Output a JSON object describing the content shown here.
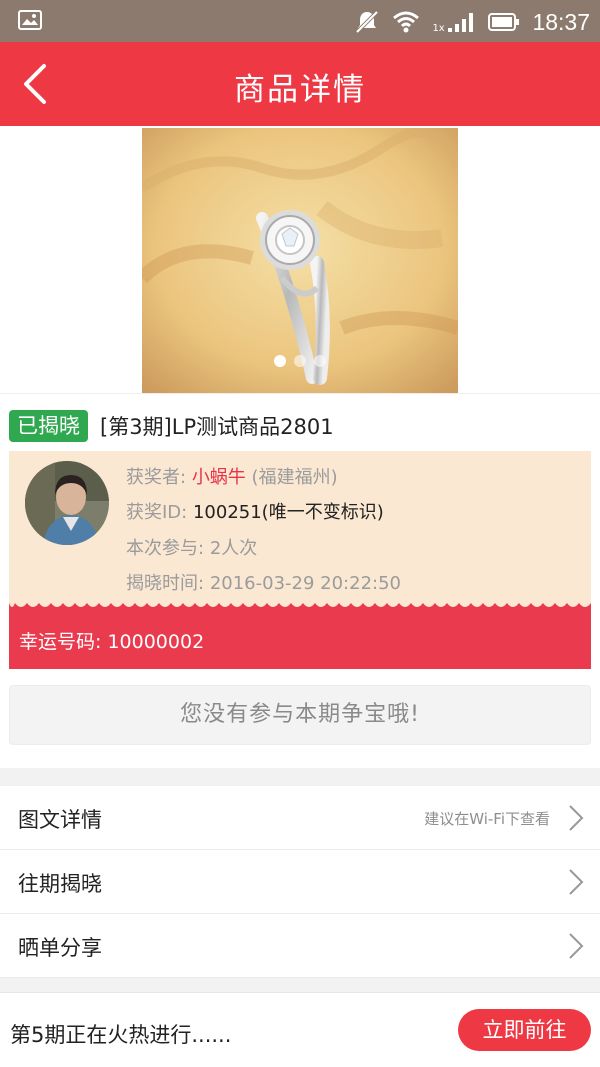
{
  "status_bar": {
    "carrier_badge": "1x",
    "time": "18:37"
  },
  "header": {
    "title": "商品详情"
  },
  "gallery": {
    "image_alt": "diamond ring on towel",
    "dots_total": 3,
    "dots_active": 1
  },
  "product": {
    "status_badge": "已揭晓",
    "title": "[第3期]LP测试商品2801"
  },
  "winner": {
    "winner_label": "获奖者:",
    "winner_name": "小蜗牛",
    "winner_location": "(福建福州)",
    "id_label": "获奖ID:",
    "id_value": "100251(唯一不变标识)",
    "participation_label": "本次参与:",
    "participation_value": "2人次",
    "reveal_label": "揭晓时间:",
    "reveal_value": "2016-03-29 20:22:50",
    "lucky_label": "幸运号码:",
    "lucky_value": "10000002"
  },
  "notice": {
    "text": "您没有参与本期争宝哦!"
  },
  "menu": {
    "items": [
      {
        "label": "图文详情",
        "hint": "建议在Wi-Fi下查看"
      },
      {
        "label": "往期揭晓",
        "hint": ""
      },
      {
        "label": "晒单分享",
        "hint": ""
      }
    ]
  },
  "bottom": {
    "text": "第5期正在火热进行......",
    "button": "立即前往"
  },
  "colors": {
    "accent": "#ee3944",
    "badge_green": "#2fa84f",
    "winner_bg": "#fbe8d3",
    "lucky_bg": "#ea3a4e"
  }
}
